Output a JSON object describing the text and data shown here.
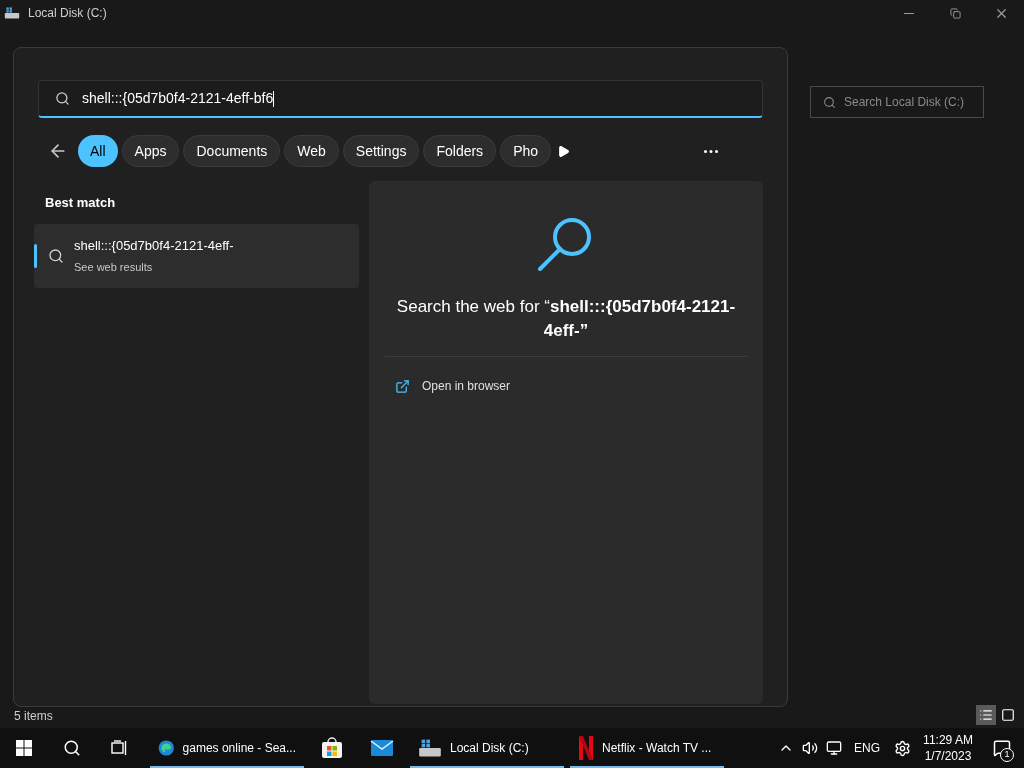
{
  "explorer": {
    "title": "Local Disk (C:)",
    "search_placeholder": "Search Local Disk (C:)",
    "status": "5 items"
  },
  "search_popup": {
    "query": "shell:::{05d7b0f4-2121-4eff-bf6",
    "filters": [
      {
        "label": "All",
        "selected": true
      },
      {
        "label": "Apps",
        "selected": false
      },
      {
        "label": "Documents",
        "selected": false
      },
      {
        "label": "Web",
        "selected": false
      },
      {
        "label": "Settings",
        "selected": false
      },
      {
        "label": "Folders",
        "selected": false
      },
      {
        "label": "Pho",
        "selected": false
      }
    ],
    "best_match_heading": "Best match",
    "results": [
      {
        "title": "shell:::{05d7b0f4-2121-4eff-",
        "subtitle": "See web results",
        "selected": true
      }
    ],
    "preview": {
      "text": "Search the web for “**shell:::{05d7b0f4-2121-4eff-”**",
      "actions": [
        "Open in browser"
      ]
    }
  },
  "taskbar": {
    "apps": [
      {
        "kind": "edge",
        "label": "games online - Sea...",
        "running": true
      },
      {
        "kind": "store",
        "running": false
      },
      {
        "kind": "mail",
        "running": false
      },
      {
        "kind": "explorer",
        "label": "Local Disk (C:)",
        "running": true
      },
      {
        "kind": "netflix",
        "label": "Netflix - Watch TV ...",
        "running": true
      }
    ],
    "language": "ENG",
    "time": "11:29 AM",
    "date": "1/7/2023",
    "notification_count": "1"
  }
}
